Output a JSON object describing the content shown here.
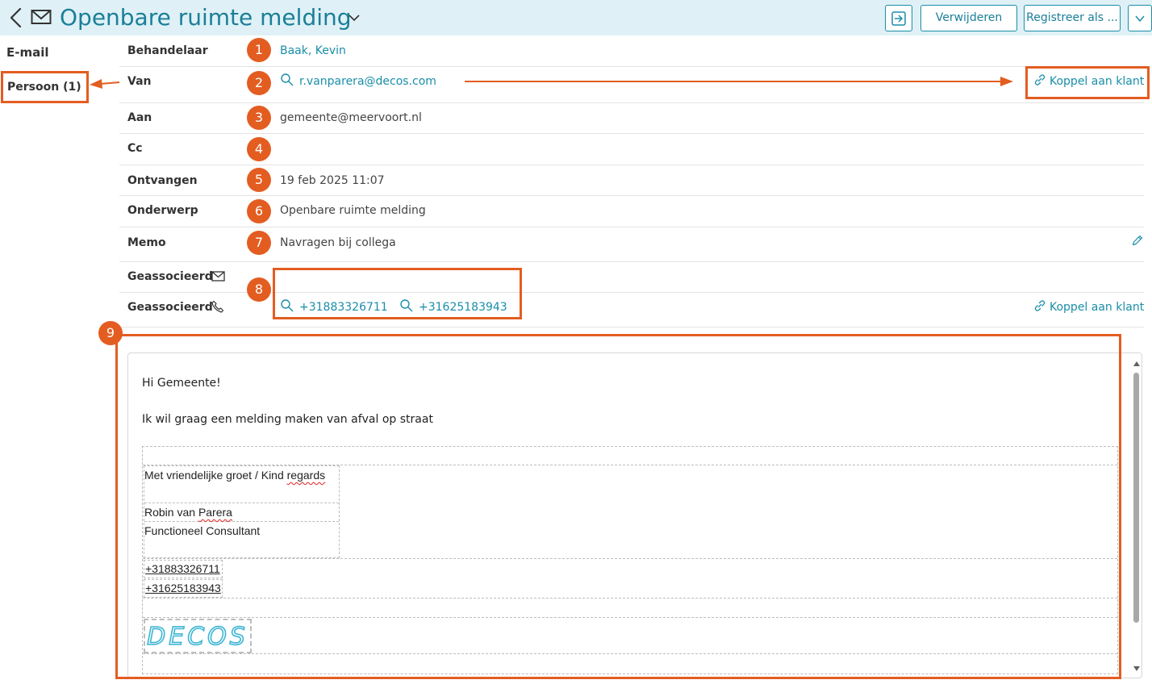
{
  "header": {
    "title": "Openbare ruimte melding",
    "buttons": {
      "delete": "Verwijderen",
      "register": "Registreer als ..."
    }
  },
  "sidebar": {
    "items": [
      {
        "label": "E-mail"
      },
      {
        "label": "Persoon (1)"
      }
    ]
  },
  "fields": {
    "behandelaar": {
      "label": "Behandelaar",
      "badge": "1",
      "value": "Baak, Kevin"
    },
    "van": {
      "label": "Van",
      "badge": "2",
      "value": "r.vanparera@decos.com",
      "action": "Koppel aan klant"
    },
    "aan": {
      "label": "Aan",
      "badge": "3",
      "value": "gemeente@meervoort.nl"
    },
    "cc": {
      "label": "Cc",
      "badge": "4",
      "value": ""
    },
    "ontvangen": {
      "label": "Ontvangen",
      "badge": "5",
      "value": "19 feb 2025 11:07"
    },
    "onderwerp": {
      "label": "Onderwerp",
      "badge": "6",
      "value": "Openbare ruimte melding"
    },
    "memo": {
      "label": "Memo",
      "badge": "7",
      "value": "Navragen bij collega"
    },
    "geassocieerd_email": {
      "label": "Geassocieerd"
    },
    "geassocieerd_phone": {
      "label": "Geassocieerd",
      "phones": [
        "+31883326711",
        "+31625183943"
      ],
      "action": "Koppel aan klant"
    },
    "assoc_badge": "8"
  },
  "body": {
    "badge": "9",
    "greeting": "Hi Gemeente!",
    "message": "Ik wil graag een melding maken van afval op straat",
    "signature": {
      "closing_a": "Met vriendelijke groet / Kind ",
      "closing_b": "regards",
      "name_a": "Robin van ",
      "name_b": "Parera",
      "role": "Functioneel Consultant",
      "phones": [
        "+31883326711",
        "+31625183943"
      ],
      "logo": "DECOS"
    }
  },
  "colors": {
    "accent": "#1a8ea8",
    "highlight": "#e35d21",
    "header_bg": "#dff1f6"
  },
  "icons": [
    "back-icon",
    "mail-icon",
    "chevron-down-icon",
    "export-icon",
    "search-icon",
    "link-icon",
    "pencil-icon",
    "phone-icon"
  ]
}
